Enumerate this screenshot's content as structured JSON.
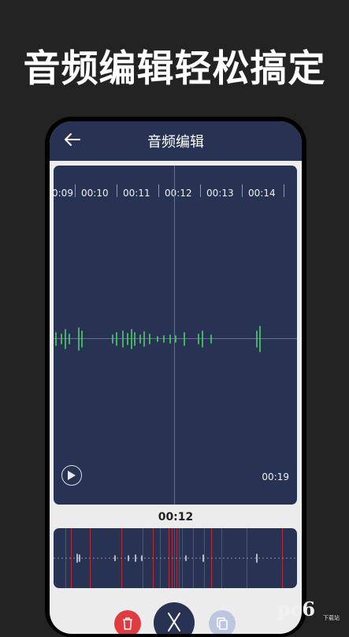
{
  "banner": {
    "text": "音频编辑轻松搞定"
  },
  "appbar": {
    "title": "音频编辑",
    "back_icon": "arrow-left-icon"
  },
  "timeline": {
    "labels": [
      "0:09",
      "00:10",
      "00:11",
      "00:12",
      "00:13",
      "00:14"
    ]
  },
  "player": {
    "duration": "00:19",
    "current_time": "00:12",
    "play_icon": "play-icon"
  },
  "controls": {
    "delete_icon": "trash-icon",
    "cut_icon": "scissors-icon",
    "copy_icon": "copy-icon"
  },
  "watermark": {
    "logo": "pc6",
    "caption": "下载站"
  },
  "colors": {
    "background": "#232323",
    "panel": "#283353",
    "wave": "#4fd06c",
    "playhead": "#8a6178",
    "marker": "#b02a3a",
    "delete": "#e23b3f"
  }
}
